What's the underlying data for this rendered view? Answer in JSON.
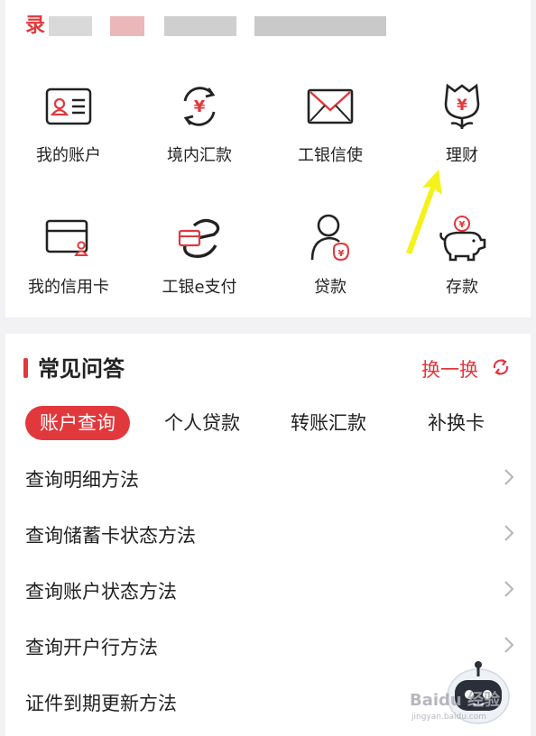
{
  "header": {
    "blurred_title_prefix": "录",
    "blur_colors": [
      "#d9d9d9",
      "#ebb7b9",
      "#cfcfcf",
      "#c9c9c9",
      "#d6d6d6"
    ]
  },
  "services": [
    {
      "label": "我的账户",
      "icon": "id-card-icon"
    },
    {
      "label": "境内汇款",
      "icon": "yuan-exchange-icon"
    },
    {
      "label": "工银信使",
      "icon": "envelope-icon"
    },
    {
      "label": "理财",
      "icon": "yuan-flower-icon"
    },
    {
      "label": "我的信用卡",
      "icon": "credit-card-icon"
    },
    {
      "label": "工银e支付",
      "icon": "e-pay-icon"
    },
    {
      "label": "贷款",
      "icon": "loan-person-icon"
    },
    {
      "label": "存款",
      "icon": "piggy-bank-icon"
    }
  ],
  "faq": {
    "title": "常见问答",
    "refresh_label": "换一换",
    "tabs": [
      {
        "label": "账户查询",
        "active": true
      },
      {
        "label": "个人贷款",
        "active": false
      },
      {
        "label": "转账汇款",
        "active": false
      },
      {
        "label": "补换卡",
        "active": false
      }
    ],
    "items": [
      "查询明细方法",
      "查询储蓄卡状态方法",
      "查询账户状态方法",
      "查询开户行方法",
      "证件到期更新方法"
    ]
  },
  "watermark": {
    "text": "Baidu 经验",
    "sub": "jingyan.baidu.com"
  },
  "colors": {
    "accent": "#e1383c",
    "annotation_arrow": "#f5f21a"
  }
}
